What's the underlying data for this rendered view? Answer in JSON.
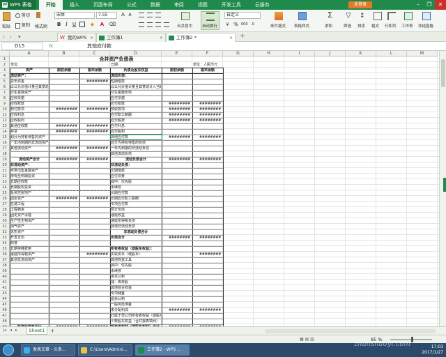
{
  "app": {
    "name": "WPS 表格",
    "tabs": [
      "开始",
      "插入",
      "页面布局",
      "公式",
      "数据",
      "审阅",
      "视图",
      "开发工具",
      "云服务"
    ],
    "login_label": "未登录"
  },
  "toolbar": {
    "paste_label": "粘贴",
    "cut_label": "剪切",
    "copy_label": "复制",
    "format_painter_label": "格式刷",
    "font_name": "宋体",
    "font_size": "7.55",
    "merge_label": "合并居中",
    "wrap_label": "自动换行",
    "number_format": "自定义",
    "conditional_format_label": "条件格式",
    "table_style_label": "表格样式",
    "sum_label": "求和",
    "filter_label": "筛选",
    "sort_label": "排序",
    "format_label": "格式",
    "row_col_label": "行和列",
    "worksheet_label": "工作表",
    "freeze_label": "冻结窗格"
  },
  "doc_tabs": [
    {
      "label": "我的WPS",
      "active": false
    },
    {
      "label": "工作簿1",
      "active": false
    },
    {
      "label": "工作簿2 *",
      "active": true
    }
  ],
  "formula_bar": {
    "cell_ref": "D15",
    "fx": "fx",
    "value": "其他应付款"
  },
  "columns": [
    "A",
    "B",
    "C",
    "D",
    "E",
    "F",
    "G",
    "H",
    "I",
    "J",
    "K",
    "L",
    "M"
  ],
  "rows": [
    "1",
    "2",
    "3",
    "4",
    "5",
    "6",
    "7",
    "8",
    "9",
    "10",
    "11",
    "12",
    "13",
    "14",
    "15",
    "16",
    "17",
    "18",
    "19",
    "20",
    "21",
    "22",
    "23",
    "24",
    "25",
    "26",
    "27",
    "28",
    "29",
    "30",
    "31",
    "32",
    "33",
    "34",
    "35",
    "36",
    "37",
    "38",
    "39",
    "40",
    "41",
    "42",
    "43",
    "44",
    "45",
    "46",
    "47",
    "48",
    "49",
    "50"
  ],
  "report": {
    "title": "合并资产负债表",
    "unit_left": "单位:",
    "date_label": "日期:",
    "unit_right": "单位：人民币元",
    "header": [
      "资产",
      "期初余额",
      "期末余额",
      "负债及股东权益",
      "期初余额",
      "期末余额"
    ],
    "left_items": [
      {
        "label": "流动资产：",
        "bold": true,
        "v1": "",
        "v2": ""
      },
      {
        "label": "货币资金",
        "v1": "",
        "v2": "########"
      },
      {
        "label": "以公允价值计量且其变动计入当期损益的金融资产",
        "v1": "",
        "v2": ""
      },
      {
        "label": "衍生金融资产",
        "v1": "",
        "v2": ""
      },
      {
        "label": "应收票据",
        "v1": "",
        "v2": ""
      },
      {
        "label": "应收账款",
        "v1": "",
        "v2": ""
      },
      {
        "label": "预付款项",
        "v1": "########",
        "v2": "########"
      },
      {
        "label": "应收利息",
        "v1": "",
        "v2": ""
      },
      {
        "label": "应收股利",
        "v1": "",
        "v2": ""
      },
      {
        "label": "其他应收款",
        "v1": "########",
        "v2": "########"
      },
      {
        "label": "存货",
        "v1": "########",
        "v2": "########"
      },
      {
        "label": "划分为持有待售的资产",
        "v1": "",
        "v2": ""
      },
      {
        "label": "一年内到期的非流动资产",
        "v1": "",
        "v2": ""
      },
      {
        "label": "其他流动资产",
        "v1": "########",
        "v2": "########"
      },
      {
        "label": "",
        "v1": "",
        "v2": ""
      },
      {
        "label": "流动资产合计",
        "bold": true,
        "center": true,
        "v1": "########",
        "v2": "########"
      },
      {
        "label": "非流动资产：",
        "bold": true,
        "v1": "",
        "v2": ""
      },
      {
        "label": "可供出售金融资产",
        "v1": "",
        "v2": ""
      },
      {
        "label": "持有至到期投资",
        "v1": "",
        "v2": ""
      },
      {
        "label": "长期应收款",
        "v1": "",
        "v2": ""
      },
      {
        "label": "长期股权投资",
        "v1": "",
        "v2": ""
      },
      {
        "label": "投资性房地产",
        "v1": "",
        "v2": ""
      },
      {
        "label": "固定资产",
        "v1": "########",
        "v2": "########"
      },
      {
        "label": "在建工程",
        "v1": "",
        "v2": ""
      },
      {
        "label": "工程物资",
        "v1": "",
        "v2": ""
      },
      {
        "label": "固定资产清理",
        "v1": "",
        "v2": ""
      },
      {
        "label": "生产性生物资产",
        "v1": "",
        "v2": ""
      },
      {
        "label": "油气资产",
        "v1": "",
        "v2": ""
      },
      {
        "label": "无形资产",
        "v1": "",
        "v2": ""
      },
      {
        "label": "开发支出",
        "v1": "",
        "v2": ""
      },
      {
        "label": "商誉",
        "v1": "",
        "v2": ""
      },
      {
        "label": "长期待摊费用",
        "v1": "",
        "v2": ""
      },
      {
        "label": "递延所得税资产",
        "v1": "",
        "v2": "########"
      },
      {
        "label": "其他非流动资产",
        "v1": "",
        "v2": ""
      }
    ],
    "left_total": {
      "label": "非流动资产合计",
      "v1": "########",
      "v2": "########"
    },
    "right_items": [
      {
        "label": "流动负债：",
        "bold": true,
        "v1": "",
        "v2": ""
      },
      {
        "label": "短期借款",
        "v1": "",
        "v2": ""
      },
      {
        "label": "以公允价值计量且其变动计入当期损益的金融负债",
        "v1": "",
        "v2": ""
      },
      {
        "label": "衍生金融负债",
        "v1": "",
        "v2": ""
      },
      {
        "label": "应付票据",
        "v1": "",
        "v2": ""
      },
      {
        "label": "应付账款",
        "v1": "########",
        "v2": "########"
      },
      {
        "label": "预收款项",
        "v1": "########",
        "v2": "########"
      },
      {
        "label": "应付职工薪酬",
        "v1": "########",
        "v2": "########"
      },
      {
        "label": "应交税费",
        "v1": "########",
        "v2": "########"
      },
      {
        "label": "应付利息",
        "v1": "",
        "v2": ""
      },
      {
        "label": "应付股利",
        "v1": "",
        "v2": ""
      },
      {
        "label": "其他应付款",
        "v1": "########",
        "v2": "########"
      },
      {
        "label": "划分为持有待售的负债",
        "v1": "",
        "v2": ""
      },
      {
        "label": "一年内到期的非流动负债",
        "v1": "",
        "v2": ""
      },
      {
        "label": "其他流动负债",
        "v1": "",
        "v2": ""
      },
      {
        "label": "流动负债合计",
        "bold": true,
        "center": true,
        "v1": "########",
        "v2": "########"
      },
      {
        "label": "非流动负债：",
        "bold": true,
        "v1": "",
        "v2": ""
      },
      {
        "label": "长期借款",
        "v1": "",
        "v2": ""
      },
      {
        "label": "应付债券",
        "v1": "",
        "v2": ""
      },
      {
        "label": "其中：优先股",
        "v1": "",
        "v2": ""
      },
      {
        "label": "永续债",
        "v1": "",
        "v2": ""
      },
      {
        "label": "长期应付款",
        "v1": "",
        "v2": ""
      },
      {
        "label": "长期应付职工薪酬",
        "v1": "",
        "v2": ""
      },
      {
        "label": "专项应付款",
        "v1": "",
        "v2": ""
      },
      {
        "label": "预计负债",
        "v1": "",
        "v2": ""
      },
      {
        "label": "递延收益",
        "v1": "",
        "v2": ""
      },
      {
        "label": "递延所得税负债",
        "v1": "",
        "v2": ""
      },
      {
        "label": "其他非流动负债",
        "v1": "",
        "v2": ""
      },
      {
        "label": "非流动负债合计",
        "bold": true,
        "center": true,
        "v1": "",
        "v2": ""
      },
      {
        "label": "负债合计",
        "bold": true,
        "v1": "########",
        "v2": "########"
      },
      {
        "label": "",
        "v1": "",
        "v2": ""
      },
      {
        "label": "所有者权益（或股东权益）：",
        "bold": true,
        "v1": "",
        "v2": ""
      },
      {
        "label": "实收资本（或股本）",
        "v1": "",
        "v2": "########"
      },
      {
        "label": "其他权益工具",
        "v1": "",
        "v2": ""
      },
      {
        "label": "其中：优先股",
        "v1": "",
        "v2": ""
      },
      {
        "label": "永续债",
        "v1": "",
        "v2": ""
      },
      {
        "label": "资本公积",
        "v1": "",
        "v2": ""
      },
      {
        "label": "减：库存股",
        "v1": "",
        "v2": ""
      },
      {
        "label": "其他综合收益",
        "v1": "",
        "v2": ""
      },
      {
        "label": "专项储备",
        "v1": "",
        "v2": ""
      },
      {
        "label": "盈余公积",
        "v1": "",
        "v2": ""
      },
      {
        "label": "一般风险准备",
        "v1": "",
        "v2": ""
      },
      {
        "label": "未分配利润",
        "v1": "########",
        "v2": "########"
      },
      {
        "label": "归属于母公司所有者权益（或股东权益）合计",
        "v1": "",
        "v2": ""
      },
      {
        "label": "少数股东权益（合并报表填列）",
        "v1": "",
        "v2": ""
      }
    ],
    "right_total": {
      "label": "所有者权益（或股东权益）合计",
      "v1": "########",
      "v2": "########"
    },
    "right_last": {
      "label": "负债和所有者权益（或股东权益）总计"
    }
  },
  "sheet_tabs": [
    "Sheet1"
  ],
  "status": {
    "zoom": "85 %"
  },
  "taskbar": {
    "items": [
      "发表文章 - 头条...",
      "C:\\Users\\Admini...",
      "工作簿2 - WPS ..."
    ],
    "time": "17:03",
    "date": "2017/1/27"
  },
  "watermark": "zhanshaoyi.com",
  "colors": {
    "accent": "#1f8a4c",
    "selection": "#1f8a4c",
    "taskbar": "#2b4a6a"
  }
}
